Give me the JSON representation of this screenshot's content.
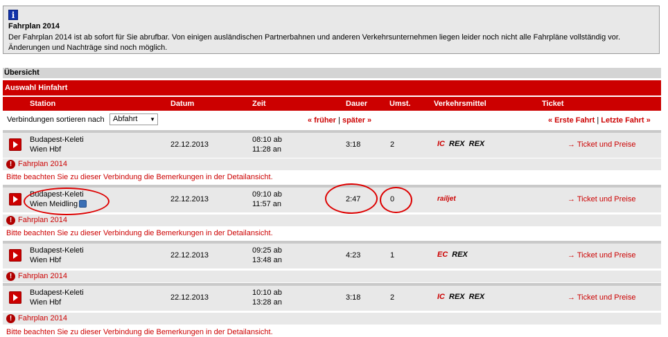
{
  "info": {
    "icon": "info-icon",
    "title": "Fahrplan 2014",
    "text": "Der Fahrplan 2014 ist ab sofort für Sie abrufbar. Von einigen ausländischen Partnerbahnen und anderen Verkehrsunternehmen liegen leider noch nicht alle Fahrpläne vollständig vor. Änderungen und Nachträge sind noch möglich."
  },
  "uebersicht": "Übersicht",
  "hinfahrt": "Auswahl Hinfahrt",
  "columns": {
    "station": "Station",
    "datum": "Datum",
    "zeit": "Zeit",
    "dauer": "Dauer",
    "umst": "Umst.",
    "verkehrsmittel": "Verkehrsmittel",
    "ticket": "Ticket"
  },
  "sort": {
    "label": "Verbindungen sortieren nach",
    "selected": "Abfahrt"
  },
  "nav": {
    "earlier": "« früher",
    "later": "später »",
    "first": "« Erste Fahrt",
    "last": "Letzte Fahrt »",
    "sep": "|"
  },
  "connections": [
    {
      "from": "Budapest-Keleti",
      "to": "Wien Hbf",
      "date": "22.12.2013",
      "dep": "08:10 ab",
      "arr": "11:28 an",
      "dauer": "3:18",
      "umst": "2",
      "vm": [
        "IC",
        "REX",
        "REX"
      ],
      "ticket": "Ticket und Preise"
    },
    {
      "from": "Budapest-Keleti",
      "to": "Wien Meidling",
      "date": "22.12.2013",
      "dep": "09:10 ab",
      "arr": "11:57 an",
      "dauer": "2:47",
      "umst": "0",
      "vm": [
        "railjet"
      ],
      "ticket": "Ticket und Preise"
    },
    {
      "from": "Budapest-Keleti",
      "to": "Wien Hbf",
      "date": "22.12.2013",
      "dep": "09:25 ab",
      "arr": "13:48 an",
      "dauer": "4:23",
      "umst": "1",
      "vm": [
        "EC",
        "REX"
      ],
      "ticket": "Ticket und Preise"
    },
    {
      "from": "Budapest-Keleti",
      "to": "Wien Hbf",
      "date": "22.12.2013",
      "dep": "10:10 ab",
      "arr": "13:28 an",
      "dauer": "3:18",
      "umst": "2",
      "vm": [
        "IC",
        "REX",
        "REX"
      ],
      "ticket": "Ticket und Preise"
    }
  ],
  "fahrplan_label": "Fahrplan 2014",
  "note": "Bitte beachten Sie zu dieser Verbindung die Bemerkungen in der Detailansicht.",
  "ticket_arrow": "→",
  "colors": {
    "accent": "#cc0000",
    "row_bg": "#e8e8e8",
    "annotation": "#dd0000"
  }
}
